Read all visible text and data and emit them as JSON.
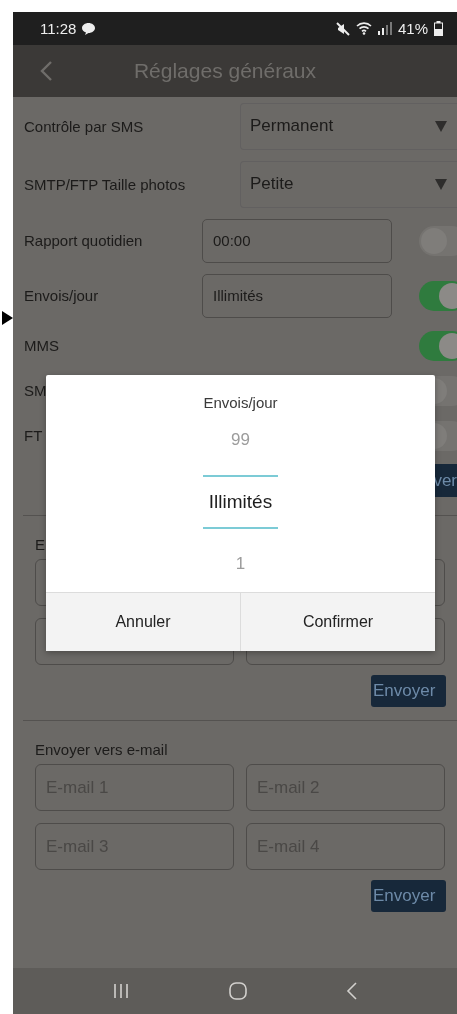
{
  "status_bar": {
    "time": "11:28",
    "battery": "41%"
  },
  "app_bar": {
    "title": "Réglages généraux"
  },
  "settings": {
    "rows": [
      {
        "kind": "select",
        "label": "Contrôle par SMS",
        "value": "Permanent"
      },
      {
        "kind": "select",
        "label": "SMTP/FTP Taille photos",
        "value": "Petite"
      },
      {
        "kind": "input",
        "label": "Rapport quotidien",
        "value": "00:00",
        "on": false
      },
      {
        "kind": "input",
        "label": "Envois/jour",
        "value": "Illimités",
        "on": true
      },
      {
        "kind": "toggle",
        "label": "MMS",
        "on": true
      },
      {
        "kind": "toggle",
        "label": "SM",
        "on": false
      },
      {
        "kind": "toggle",
        "label": "FT",
        "on": false
      }
    ],
    "button": "ver"
  },
  "sections": [
    {
      "title": "E",
      "fields": [
        {
          "kind": "email"
        },
        {
          "kind": "email"
        },
        {
          "kind": "email"
        },
        {
          "kind": "email"
        }
      ],
      "button": "Envoyer"
    },
    {
      "title": "Envoyer vers e-mail",
      "fields": [
        {
          "kind": "email",
          "placeholder": "E-mail 1"
        },
        {
          "kind": "email",
          "placeholder": "E-mail 2"
        },
        {
          "kind": "email",
          "placeholder": "E-mail 3"
        },
        {
          "kind": "email",
          "placeholder": "E-mail 4"
        }
      ],
      "button": "Envoyer"
    }
  ],
  "dialog": {
    "title": "Envois/jour",
    "options": [
      {
        "label": "99",
        "selected": false
      },
      {
        "label": "Illimités",
        "selected": true
      },
      {
        "label": "1",
        "selected": false
      }
    ],
    "buttons": [
      "Annuler",
      "Confirmer"
    ]
  }
}
